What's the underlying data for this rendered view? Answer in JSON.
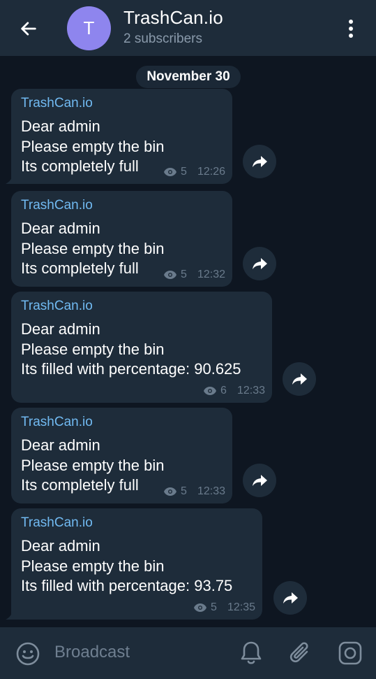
{
  "header": {
    "avatar_letter": "T",
    "title": "TrashCan.io",
    "subtitle": "2 subscribers"
  },
  "date_chip": "November 30",
  "messages": [
    {
      "sender": "TrashCan.io",
      "lines": [
        "Dear admin",
        "Please empty the bin",
        "Its completely full"
      ],
      "views": "5",
      "time": "12:26"
    },
    {
      "sender": "TrashCan.io",
      "lines": [
        "Dear admin",
        "Please empty the bin",
        "Its completely full"
      ],
      "views": "5",
      "time": "12:32"
    },
    {
      "sender": "TrashCan.io",
      "lines": [
        "Dear admin",
        "Please empty the bin",
        "Its filled with percentage: 90.625"
      ],
      "views": "6",
      "time": "12:33"
    },
    {
      "sender": "TrashCan.io",
      "lines": [
        "Dear admin",
        "Please empty the bin",
        "Its completely full"
      ],
      "views": "5",
      "time": "12:33"
    },
    {
      "sender": "TrashCan.io",
      "lines": [
        "Dear admin",
        "Please empty the bin",
        "Its filled with percentage: 93.75"
      ],
      "views": "5",
      "time": "12:35"
    }
  ],
  "composer": {
    "placeholder": "Broadcast"
  },
  "colors": {
    "background": "#0e1621",
    "panel": "#1e2c3a",
    "accent_name": "#71baf2",
    "avatar": "#8e85ee",
    "muted": "#6a7b8c"
  },
  "icons": [
    "back-arrow-icon",
    "more-vertical-icon",
    "eye-icon",
    "share-icon",
    "emoji-icon",
    "bell-icon",
    "paperclip-icon",
    "camera-icon"
  ]
}
